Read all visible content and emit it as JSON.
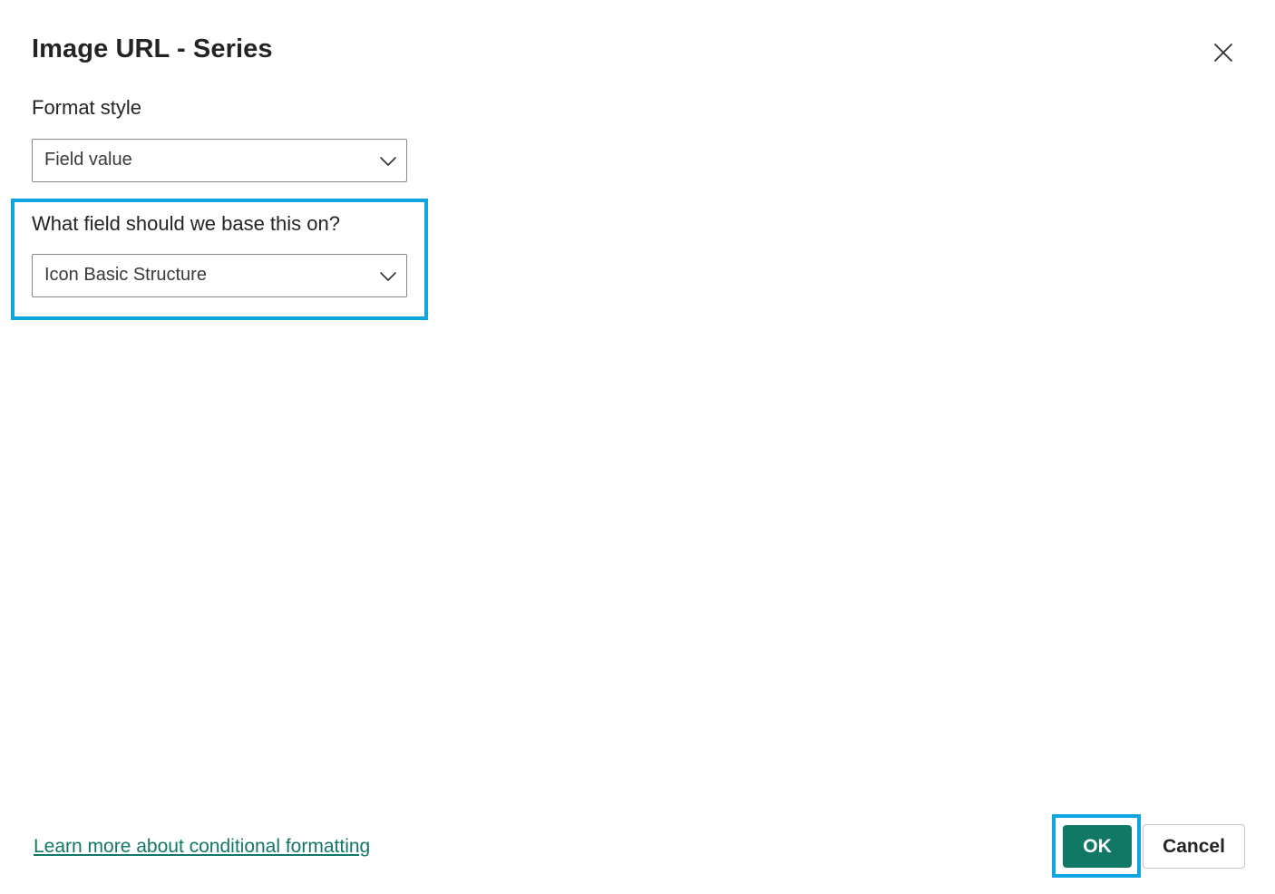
{
  "dialog": {
    "title": "Image URL - Series",
    "close_icon": "close-icon"
  },
  "format_style": {
    "label": "Format style",
    "selected": "Field value",
    "chevron_icon": "chevron-down-icon"
  },
  "base_field": {
    "label": "What field should we base this on?",
    "selected": "Icon Basic Structure",
    "chevron_icon": "chevron-down-icon"
  },
  "footer": {
    "learn_more_link": "Learn more about conditional formatting",
    "ok_label": "OK",
    "cancel_label": "Cancel"
  },
  "colors": {
    "accent": "#117865",
    "highlight": "#0ea5e0"
  }
}
